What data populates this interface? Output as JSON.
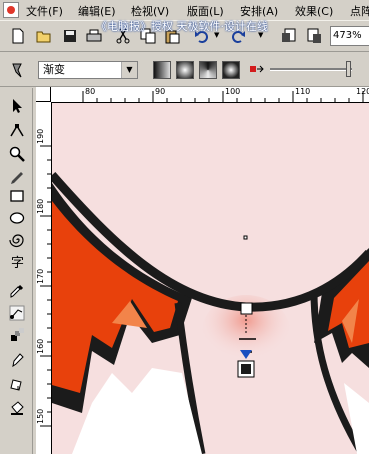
{
  "menu": {
    "items": [
      "文件(F)",
      "编辑(E)",
      "检视(V)",
      "版面(L)",
      "安排(A)",
      "效果(C)",
      "点阵"
    ]
  },
  "watermark": "《电脑报》授权 天极软件·设计在线",
  "toolbar": {
    "zoom": "473%",
    "icons": [
      "new-icon",
      "open-icon",
      "save-icon",
      "print-icon",
      "cut-icon",
      "copy-icon",
      "paste-icon",
      "undo-icon",
      "redo-icon",
      "import-icon",
      "export-icon"
    ]
  },
  "propbar": {
    "fill_type": "渐变",
    "gradient_types": [
      "linear",
      "radial",
      "conical",
      "square"
    ]
  },
  "toolbox": {
    "tools": [
      "pick-tool",
      "shape-tool",
      "zoom-tool",
      "freehand-tool",
      "rectangle-tool",
      "ellipse-tool",
      "spiral-tool",
      "text-tool",
      "eyedropper-tool",
      "interactive-fill-tool",
      "transparency-tool",
      "outline-tool",
      "fill-tool",
      "bucket-tool"
    ]
  },
  "rulers": {
    "top": [
      "80",
      "90",
      "100",
      "110",
      "120"
    ],
    "left": [
      "190",
      "180",
      "170",
      "160",
      "150"
    ]
  },
  "colors": {
    "chrome": "#d4d0c8",
    "skin": "#f6dfdf",
    "hair_orange": "#e8410c",
    "outline": "#1b1b1b",
    "gradient_handle": "#1a4fc0"
  }
}
